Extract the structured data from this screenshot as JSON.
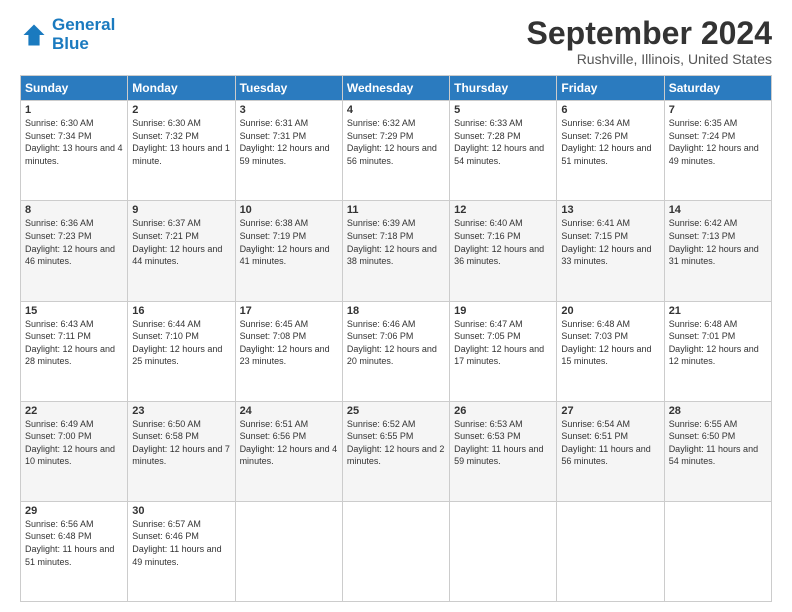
{
  "header": {
    "logo_line1": "General",
    "logo_line2": "Blue",
    "title": "September 2024",
    "subtitle": "Rushville, Illinois, United States"
  },
  "days_of_week": [
    "Sunday",
    "Monday",
    "Tuesday",
    "Wednesday",
    "Thursday",
    "Friday",
    "Saturday"
  ],
  "weeks": [
    [
      {
        "day": "1",
        "sunrise": "6:30 AM",
        "sunset": "7:34 PM",
        "daylight": "13 hours and 4 minutes."
      },
      {
        "day": "2",
        "sunrise": "6:30 AM",
        "sunset": "7:32 PM",
        "daylight": "13 hours and 1 minute."
      },
      {
        "day": "3",
        "sunrise": "6:31 AM",
        "sunset": "7:31 PM",
        "daylight": "12 hours and 59 minutes."
      },
      {
        "day": "4",
        "sunrise": "6:32 AM",
        "sunset": "7:29 PM",
        "daylight": "12 hours and 56 minutes."
      },
      {
        "day": "5",
        "sunrise": "6:33 AM",
        "sunset": "7:28 PM",
        "daylight": "12 hours and 54 minutes."
      },
      {
        "day": "6",
        "sunrise": "6:34 AM",
        "sunset": "7:26 PM",
        "daylight": "12 hours and 51 minutes."
      },
      {
        "day": "7",
        "sunrise": "6:35 AM",
        "sunset": "7:24 PM",
        "daylight": "12 hours and 49 minutes."
      }
    ],
    [
      {
        "day": "8",
        "sunrise": "6:36 AM",
        "sunset": "7:23 PM",
        "daylight": "12 hours and 46 minutes."
      },
      {
        "day": "9",
        "sunrise": "6:37 AM",
        "sunset": "7:21 PM",
        "daylight": "12 hours and 44 minutes."
      },
      {
        "day": "10",
        "sunrise": "6:38 AM",
        "sunset": "7:19 PM",
        "daylight": "12 hours and 41 minutes."
      },
      {
        "day": "11",
        "sunrise": "6:39 AM",
        "sunset": "7:18 PM",
        "daylight": "12 hours and 38 minutes."
      },
      {
        "day": "12",
        "sunrise": "6:40 AM",
        "sunset": "7:16 PM",
        "daylight": "12 hours and 36 minutes."
      },
      {
        "day": "13",
        "sunrise": "6:41 AM",
        "sunset": "7:15 PM",
        "daylight": "12 hours and 33 minutes."
      },
      {
        "day": "14",
        "sunrise": "6:42 AM",
        "sunset": "7:13 PM",
        "daylight": "12 hours and 31 minutes."
      }
    ],
    [
      {
        "day": "15",
        "sunrise": "6:43 AM",
        "sunset": "7:11 PM",
        "daylight": "12 hours and 28 minutes."
      },
      {
        "day": "16",
        "sunrise": "6:44 AM",
        "sunset": "7:10 PM",
        "daylight": "12 hours and 25 minutes."
      },
      {
        "day": "17",
        "sunrise": "6:45 AM",
        "sunset": "7:08 PM",
        "daylight": "12 hours and 23 minutes."
      },
      {
        "day": "18",
        "sunrise": "6:46 AM",
        "sunset": "7:06 PM",
        "daylight": "12 hours and 20 minutes."
      },
      {
        "day": "19",
        "sunrise": "6:47 AM",
        "sunset": "7:05 PM",
        "daylight": "12 hours and 17 minutes."
      },
      {
        "day": "20",
        "sunrise": "6:48 AM",
        "sunset": "7:03 PM",
        "daylight": "12 hours and 15 minutes."
      },
      {
        "day": "21",
        "sunrise": "6:48 AM",
        "sunset": "7:01 PM",
        "daylight": "12 hours and 12 minutes."
      }
    ],
    [
      {
        "day": "22",
        "sunrise": "6:49 AM",
        "sunset": "7:00 PM",
        "daylight": "12 hours and 10 minutes."
      },
      {
        "day": "23",
        "sunrise": "6:50 AM",
        "sunset": "6:58 PM",
        "daylight": "12 hours and 7 minutes."
      },
      {
        "day": "24",
        "sunrise": "6:51 AM",
        "sunset": "6:56 PM",
        "daylight": "12 hours and 4 minutes."
      },
      {
        "day": "25",
        "sunrise": "6:52 AM",
        "sunset": "6:55 PM",
        "daylight": "12 hours and 2 minutes."
      },
      {
        "day": "26",
        "sunrise": "6:53 AM",
        "sunset": "6:53 PM",
        "daylight": "11 hours and 59 minutes."
      },
      {
        "day": "27",
        "sunrise": "6:54 AM",
        "sunset": "6:51 PM",
        "daylight": "11 hours and 56 minutes."
      },
      {
        "day": "28",
        "sunrise": "6:55 AM",
        "sunset": "6:50 PM",
        "daylight": "11 hours and 54 minutes."
      }
    ],
    [
      {
        "day": "29",
        "sunrise": "6:56 AM",
        "sunset": "6:48 PM",
        "daylight": "11 hours and 51 minutes."
      },
      {
        "day": "30",
        "sunrise": "6:57 AM",
        "sunset": "6:46 PM",
        "daylight": "11 hours and 49 minutes."
      },
      null,
      null,
      null,
      null,
      null
    ]
  ]
}
